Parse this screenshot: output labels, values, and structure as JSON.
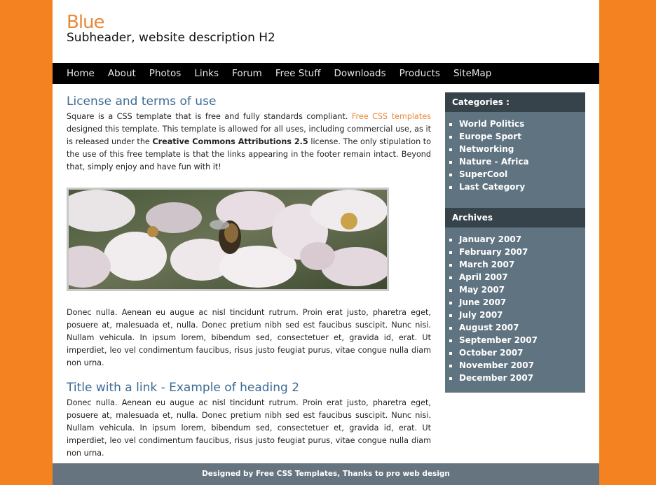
{
  "header": {
    "title": "Blue",
    "subtitle": "Subheader, website description H2"
  },
  "nav": {
    "items": [
      "Home",
      "About",
      "Photos",
      "Links",
      "Forum",
      "Free Stuff",
      "Downloads",
      "Products",
      "SiteMap"
    ]
  },
  "content": {
    "heading1": "License and terms of use",
    "para1": {
      "part1": "Square is a CSS template that is free and fully standards compliant. ",
      "link": "Free CSS templates",
      "part2": " designed this template. This template is allowed for all uses, including commercial use, as it is released under the ",
      "bold": "Creative Commons Attributions 2.5",
      "part3": " license. The only stipulation to the use of this free template is that the links appearing in the footer remain intact. Beyond that, simply enjoy and have fun with it!"
    },
    "para2": "Donec nulla. Aenean eu augue ac nisl tincidunt rutrum. Proin erat justo, pharetra eget, posuere at, malesuada et, nulla. Donec pretium nibh sed est faucibus suscipit. Nunc nisi. Nullam vehicula. In ipsum lorem, bibendum sed, consectetuer et, gravida id, erat. Ut imperdiet, leo vel condimentum faucibus, risus justo feugiat purus, vitae congue nulla diam non urna.",
    "heading2": "Title with a link - Example of heading 2",
    "para3": "Donec nulla. Aenean eu augue ac nisl tincidunt rutrum. Proin erat justo, pharetra eget, posuere at, malesuada et, nulla. Donec pretium nibh sed est faucibus suscipit. Nunc nisi. Nullam vehicula. In ipsum lorem, bibendum sed, consectetuer et, gravida id, erat. Ut imperdiet, leo vel condimentum faucibus, risus justo feugiat purus, vitae congue nulla diam non urna."
  },
  "sidebar": {
    "categories_title": "Categories :",
    "categories": [
      "World Politics",
      "Europe Sport",
      "Networking",
      "Nature - Africa",
      "SuperCool",
      "Last Category"
    ],
    "archives_title": "Archives",
    "archives": [
      "January 2007",
      "February 2007",
      "March 2007",
      "April 2007",
      "May 2007",
      "June 2007",
      "July 2007",
      "August 2007",
      "September 2007",
      "October 2007",
      "November 2007",
      "December 2007"
    ]
  },
  "footer": {
    "text": "Designed by Free CSS Templates, Thanks to pro web design"
  },
  "colors": {
    "background": "#f58220",
    "title": "#e8893a",
    "heading": "#3c6b94",
    "sidebar": "#5f7380",
    "sidebar_header": "#37434b",
    "footer": "#65747e"
  }
}
